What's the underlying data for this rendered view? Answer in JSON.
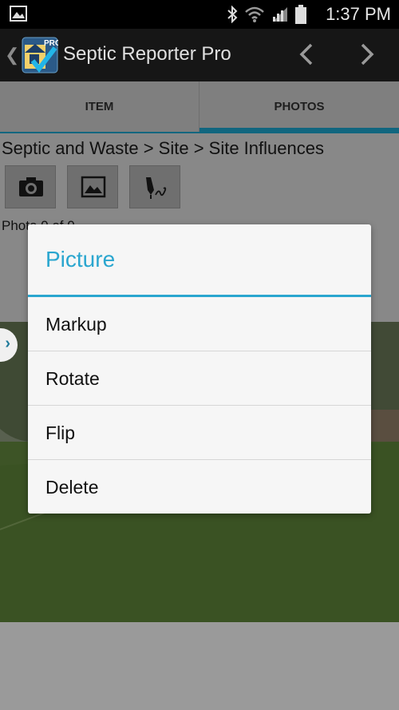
{
  "status_bar": {
    "time": "1:37 PM"
  },
  "action_bar": {
    "title": "Septic Reporter Pro",
    "app_icon_badge": "PRO"
  },
  "tabs": [
    {
      "label": "ITEM"
    },
    {
      "label": "PHOTOS"
    }
  ],
  "breadcrumb": "Septic and Waste > Site > Site Influences",
  "photo_count": "Photo 0 of 0",
  "dialog": {
    "title": "Picture",
    "items": [
      {
        "label": "Markup"
      },
      {
        "label": "Rotate"
      },
      {
        "label": "Flip"
      },
      {
        "label": "Delete"
      }
    ]
  },
  "colors": {
    "accent": "#2aa6cf",
    "tab_indicator": "#11667f"
  }
}
